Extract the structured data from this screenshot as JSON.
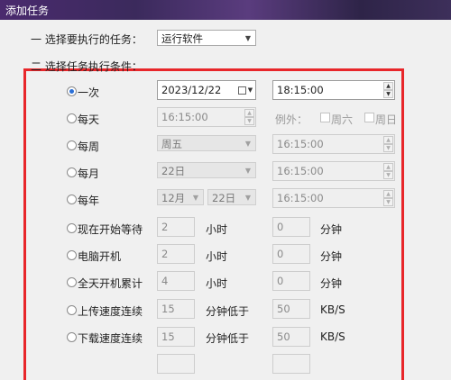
{
  "window": {
    "title": "添加任务"
  },
  "task_select": {
    "label": "一 选择要执行的任务：",
    "value": "运行软件"
  },
  "conditions": {
    "label": "二 选择任务执行条件：",
    "once": {
      "label": "一次",
      "date": "2023/12/22",
      "time": "18:15:00"
    },
    "daily": {
      "label": "每天",
      "time": "16:15:00",
      "except_label": "例外：",
      "sat_label": "周六",
      "sun_label": "周日"
    },
    "weekly": {
      "label": "每周",
      "day": "周五",
      "time": "16:15:00"
    },
    "monthly": {
      "label": "每月",
      "day": "22日",
      "time": "16:15:00"
    },
    "yearly": {
      "label": "每年",
      "month": "12月",
      "day": "22日",
      "time": "16:15:00"
    },
    "wait": {
      "label": "现在开始等待",
      "hours": "2",
      "hours_unit": "小时",
      "minutes": "0",
      "minutes_unit": "分钟"
    },
    "boot": {
      "label": "电脑开机",
      "hours": "2",
      "hours_unit": "小时",
      "minutes": "0",
      "minutes_unit": "分钟"
    },
    "uptime": {
      "label": "全天开机累计",
      "hours": "4",
      "hours_unit": "小时",
      "minutes": "0",
      "minutes_unit": "分钟"
    },
    "upload": {
      "label": "上传速度连续",
      "minutes": "15",
      "minutes_unit": "分钟低于",
      "speed": "50",
      "speed_unit": "KB/S"
    },
    "download": {
      "label": "下载速度连续",
      "minutes": "15",
      "minutes_unit": "分钟低于",
      "speed": "50",
      "speed_unit": "KB/S"
    }
  }
}
